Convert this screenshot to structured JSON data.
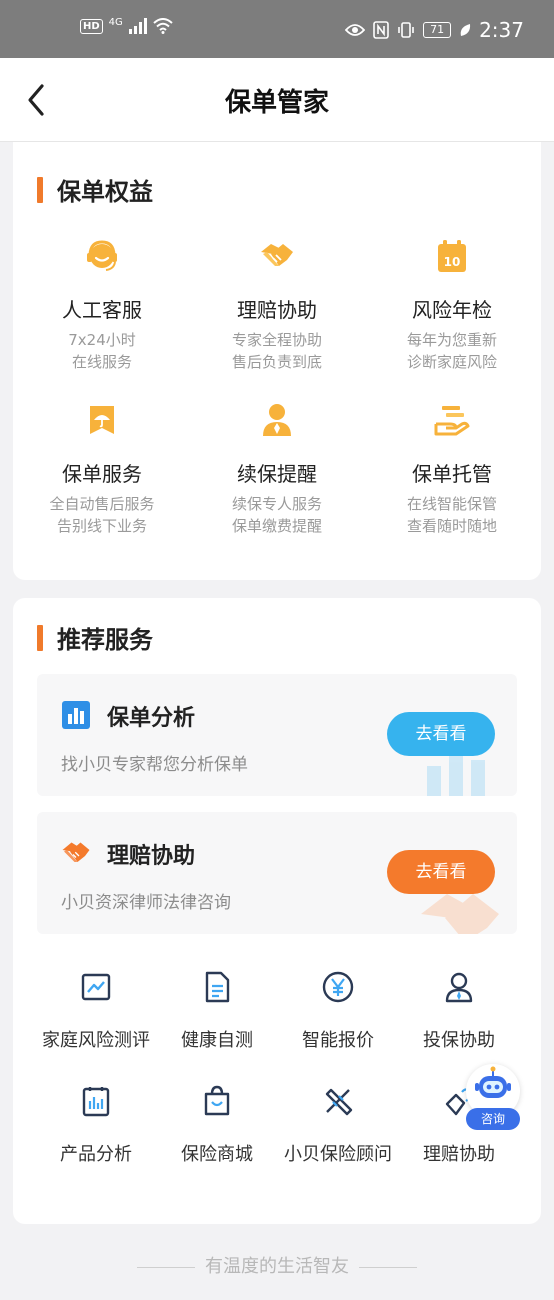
{
  "status_bar": {
    "hd": "HD",
    "network": "4G",
    "battery": "71",
    "time": "2:37"
  },
  "header": {
    "title": "保单管家"
  },
  "benefits": {
    "title": "保单权益",
    "items": [
      {
        "name": "人工客服",
        "desc1": "7x24小时",
        "desc2": "在线服务",
        "icon": "headset-icon"
      },
      {
        "name": "理赔协助",
        "desc1": "专家全程协助",
        "desc2": "售后负责到底",
        "icon": "handshake-icon"
      },
      {
        "name": "风险年检",
        "desc1": "每年为您重新",
        "desc2": "诊断家庭风险",
        "icon": "calendar-icon",
        "icon_text": "10"
      },
      {
        "name": "保单服务",
        "desc1": "全自动售后服务",
        "desc2": "告别线下业务",
        "icon": "umbrella-icon"
      },
      {
        "name": "续保提醒",
        "desc1": "续保专人服务",
        "desc2": "保单缴费提醒",
        "icon": "agent-icon"
      },
      {
        "name": "保单托管",
        "desc1": "在线智能保管",
        "desc2": "查看随时随地",
        "icon": "hand-card-icon"
      }
    ]
  },
  "recommend": {
    "title": "推荐服务",
    "promos": [
      {
        "title": "保单分析",
        "subtitle": "找小贝专家帮您分析保单",
        "button": "去看看",
        "icon": "bar-chart-icon"
      },
      {
        "title": "理赔协助",
        "subtitle": "小贝资深律师法律咨询",
        "button": "去看看",
        "icon": "handshake-icon"
      }
    ],
    "services": [
      {
        "label": "家庭风险测评",
        "icon": "line-chart-icon"
      },
      {
        "label": "健康自测",
        "icon": "document-icon"
      },
      {
        "label": "智能报价",
        "icon": "yen-icon"
      },
      {
        "label": "投保协助",
        "icon": "person-icon"
      },
      {
        "label": "产品分析",
        "icon": "clipboard-chart-icon"
      },
      {
        "label": "保险商城",
        "icon": "shopping-bag-icon"
      },
      {
        "label": "小贝保险顾问",
        "icon": "tools-icon"
      },
      {
        "label": "理赔协助",
        "icon": "hand-heart-icon"
      }
    ]
  },
  "assistant": {
    "label": "咨询"
  },
  "footer": {
    "text": "有温度的生活智友"
  },
  "colors": {
    "accent_orange": "#f07a2b",
    "icon_orange": "#f7b23b",
    "button_blue": "#36b3ee",
    "button_orange": "#f47a2c",
    "icon_blue": "#2f8fe6"
  }
}
